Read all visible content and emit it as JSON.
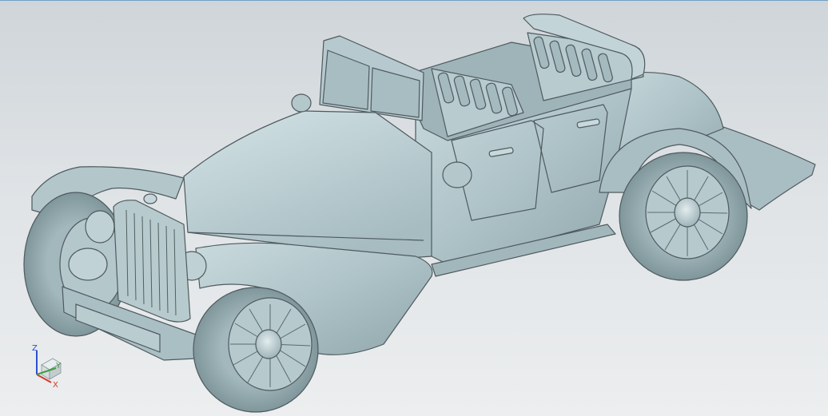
{
  "viewport": {
    "model_name": "",
    "model_color": "#b3c7cb",
    "edge_color": "#4e5a5e"
  },
  "triad": {
    "x_label": "X",
    "y_label": "Y",
    "z_label": "Z",
    "x_color": "#d23a2a",
    "y_color": "#3f9f3f",
    "z_color": "#2c4fd0"
  }
}
